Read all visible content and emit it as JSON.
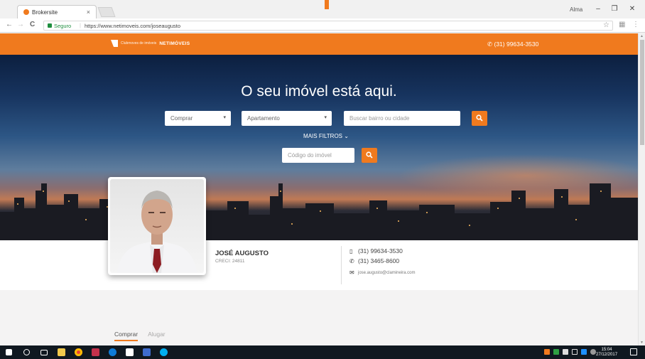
{
  "browser": {
    "tab_title": "Brokersite",
    "tab_close": "×",
    "user_label": "Alma",
    "window_controls": {
      "minimize": "–",
      "maximize": "❐",
      "close": "✕"
    },
    "nav": {
      "back": "←",
      "forward": "→",
      "reload": "C"
    },
    "secure_label": "Seguro",
    "url": "https://www.netimoveis.com/joseaugusto"
  },
  "header": {
    "logo_sub": "Clubmoves de imóveis",
    "logo_brand": "NETIMÓVEIS",
    "phone": "(31) 99634-3530"
  },
  "hero": {
    "title": "O seu imóvel está aqui.",
    "mode_select": "Comprar",
    "type_select": "Apartamento",
    "location_placeholder": "Buscar bairro ou cidade",
    "more_filters": "MAIS FILTROS ⌄",
    "code_placeholder": "Código do imóvel"
  },
  "agent": {
    "name": "JOSÉ AUGUSTO",
    "creci": "CRECI: 24811",
    "mobile": "(31) 99634-3530",
    "phone": "(31) 3465-8600",
    "email": "jose.augusto@clamineira.com"
  },
  "listing_tabs": [
    {
      "label": "Comprar",
      "active": true
    },
    {
      "label": "Alugar",
      "active": false
    }
  ],
  "taskbar": {
    "time": "15:04",
    "date": "27/12/2017"
  },
  "colors": {
    "brand_orange": "#f07a1e",
    "taskbar": "#101820"
  }
}
